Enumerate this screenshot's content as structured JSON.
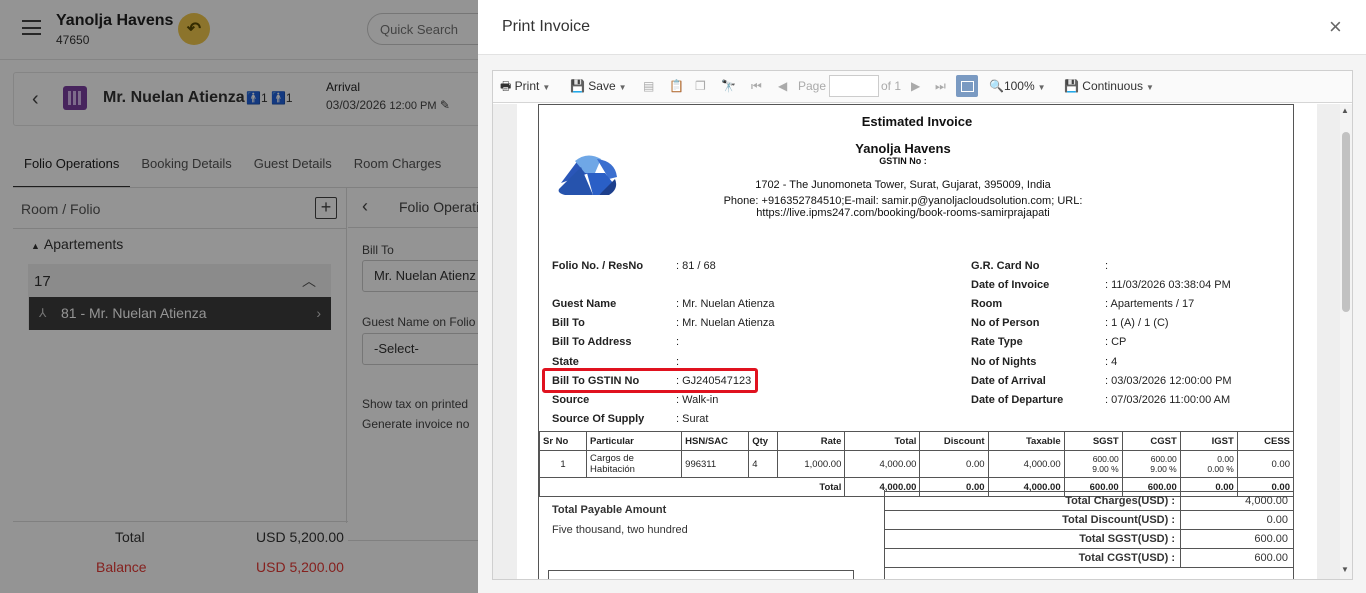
{
  "app": {
    "hotel_name": "Yanolja Havens",
    "hotel_code": "47650",
    "switch_icon": "↶",
    "search_placeholder": "Quick Search"
  },
  "guest": {
    "name": "Mr. Nuelan Atienza",
    "persons": "🚹1 🚹1",
    "arrival_label": "Arrival",
    "arrival_date": "03/03/2026",
    "arrival_time": "12:00 PM"
  },
  "tabs": [
    "Folio Operations",
    "Booking Details",
    "Guest Details",
    "Room Charges"
  ],
  "room_folio": {
    "title": "Room / Folio",
    "group": "Apartements",
    "room": "17",
    "folio_item": "81 - Mr. Nuelan Atienza"
  },
  "folio_ops": {
    "title": "Folio Operati",
    "bill_to_label": "Bill To",
    "bill_to_value": "Mr. Nuelan Atienz",
    "guest_name_label": "Guest Name on Folio",
    "guest_name_value": "-Select-",
    "tax_text": "Show tax on printed",
    "generate_text": "Generate invoice no"
  },
  "totals": {
    "total_label": "Total",
    "total_value": "USD 5,200.00",
    "balance_label": "Balance",
    "balance_value": "USD 5,200.00"
  },
  "dialog": {
    "title": "Print Invoice",
    "close": "×"
  },
  "toolbar": {
    "print": "Print",
    "save": "Save",
    "page_label": "Page",
    "page_of": "of 1",
    "zoom": "100%",
    "view_mode": "Continuous"
  },
  "invoice": {
    "title": "Estimated Invoice",
    "hotel": "Yanolja Havens",
    "gstin": "GSTIN No :",
    "address": "1702 - The Junomoneta Tower, Surat, Gujarat, 395009, India",
    "contact_line1": "Phone: +916352784510;E-mail: samir.p@yanoljacloudsolution.com; URL:",
    "contact_line2": "https://live.ipms247.com/booking/book-rooms-samirprajapati",
    "left_fields": [
      {
        "label": "Folio No. / ResNo",
        "value": ": 81 / 68"
      },
      {
        "label": "Guest Name",
        "value": ": Mr. Nuelan Atienza"
      },
      {
        "label": "Bill To",
        "value": ": Mr. Nuelan Atienza"
      },
      {
        "label": "Bill To Address",
        "value": ":"
      },
      {
        "label": "State",
        "value": ":"
      },
      {
        "label": "Bill To GSTIN No",
        "value": ": GJ240547123"
      },
      {
        "label": "Source",
        "value": ": Walk-in"
      },
      {
        "label": "Source Of Supply",
        "value": ": Surat"
      }
    ],
    "right_fields": [
      {
        "label": "G.R. Card No",
        "value": ":"
      },
      {
        "label": "Date of Invoice",
        "value": ": 11/03/2026 03:38:04 PM"
      },
      {
        "label": "Room",
        "value": ": Apartements / 17"
      },
      {
        "label": "No of Person",
        "value": ": 1 (A) / 1 (C)"
      },
      {
        "label": "Rate Type",
        "value": ": CP"
      },
      {
        "label": "No of Nights",
        "value": ": 4"
      },
      {
        "label": "Date of Arrival",
        "value": ": 03/03/2026 12:00:00 PM"
      },
      {
        "label": "Date of Departure",
        "value": ": 07/03/2026 11:00:00 AM"
      }
    ],
    "table_headers": [
      "Sr No",
      "Particular",
      "HSN/SAC",
      "Qty",
      "Rate",
      "Total",
      "Discount",
      "Taxable",
      "SGST",
      "CGST",
      "IGST",
      "CESS"
    ],
    "row": {
      "sr": "1",
      "particular": "Cargos de Habitación",
      "hsn": "996311",
      "qty": "4",
      "rate": "1,000.00",
      "total": "4,000.00",
      "discount": "0.00",
      "taxable": "4,000.00",
      "sgst_amt": "600.00",
      "sgst_pct": "9.00 %",
      "cgst_amt": "600.00",
      "cgst_pct": "9.00 %",
      "igst_amt": "0.00",
      "igst_pct": "0.00 %",
      "cess": "0.00"
    },
    "total_row": {
      "label": "Total",
      "total": "4,000.00",
      "discount": "0.00",
      "taxable": "4,000.00",
      "sgst": "600.00",
      "cgst": "600.00",
      "igst": "0.00",
      "cess": "0.00"
    },
    "payable_label": "Total Payable Amount",
    "payable_words": "Five thousand, two hundred",
    "summary": [
      {
        "label": "Total Charges(USD) :",
        "value": "4,000.00"
      },
      {
        "label": "Total Discount(USD) :",
        "value": "0.00"
      },
      {
        "label": "Total SGST(USD) :",
        "value": "600.00"
      },
      {
        "label": "Total CGST(USD) :",
        "value": "600.00"
      }
    ],
    "highlight_color": "#e0121f"
  }
}
